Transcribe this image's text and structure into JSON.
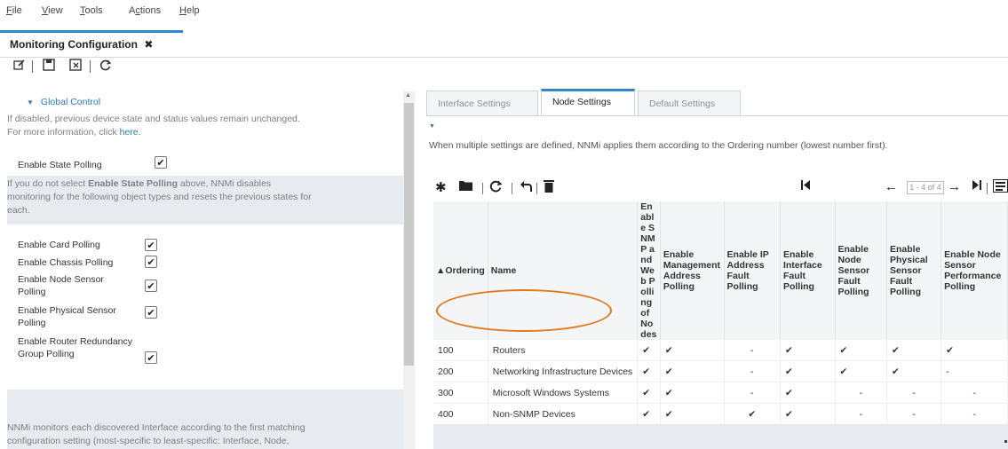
{
  "menu": {
    "items": [
      {
        "pre": "",
        "u": "F",
        "post": "ile"
      },
      {
        "pre": "",
        "u": "V",
        "post": "iew"
      },
      {
        "pre": "",
        "u": "T",
        "post": "ools"
      },
      {
        "pre": "A",
        "u": "c",
        "post": "tions"
      },
      {
        "pre": "",
        "u": "H",
        "post": "elp"
      }
    ]
  },
  "main_tab": {
    "label": "Monitoring Configuration",
    "close": "✖"
  },
  "toolbar": {
    "icons": [
      "edit-icon",
      "save-icon",
      "save-close-icon",
      "refresh-icon"
    ]
  },
  "left": {
    "global_control": "Global Control",
    "intro_line1": "If disabled, previous device state and status values remain unchanged.",
    "intro_line2": "For more information, click ",
    "intro_link": "here",
    "enable_state_polling": "Enable State Polling",
    "note_line1_pre": "If you do not select ",
    "note_line1_bold": "Enable State Polling",
    "note_line1_post": " above, NNMi disables",
    "note_line2": "monitoring for the following object types and resets the previous states for",
    "note_line3": "each.",
    "checkboxes": [
      {
        "label": "Enable Card Polling",
        "checked": true
      },
      {
        "label": "Enable Chassis Polling",
        "checked": true
      },
      {
        "label": "Enable Node Sensor Polling",
        "checked": true
      },
      {
        "label": "Enable Physical Sensor Polling",
        "checked": true
      },
      {
        "label": "Enable Router Redundancy Group Polling",
        "checked": true
      }
    ],
    "bottom_line1": "NNMi monitors each discovered Interface according to the first matching",
    "bottom_line2": "configuration setting (most-specific to least-specific: Interface, Node,"
  },
  "right": {
    "subtabs": [
      "Interface Settings",
      "Node Settings",
      "Default Settings"
    ],
    "active_subtab": "Node Settings",
    "order_note": "When multiple settings are defined, NNMi applies them according to the Ordering number (lowest number first).",
    "pager": {
      "range": "1 - 4 of 4"
    },
    "table": {
      "columns": [
        "▲Ordering",
        "Name",
        "Enable SNMP and Web Polling of Nodes",
        "Enable Management Address Polling",
        "Enable IP Address Fault Polling",
        "Enable Interface Fault Polling",
        "Enable Node Sensor Fault Polling",
        "Enable Physical Sensor Fault Polling",
        "Enable Node Sensor Performance Polling"
      ],
      "rows": [
        {
          "order": "100",
          "name": "Routers",
          "vals": [
            "✔",
            "✔",
            "-",
            "✔",
            "✔",
            "✔",
            "✔"
          ]
        },
        {
          "order": "200",
          "name": "Networking Infrastructure Devices",
          "vals": [
            "✔",
            "✔",
            "-",
            "✔",
            "✔",
            "✔",
            "-"
          ]
        },
        {
          "order": "300",
          "name": "Microsoft Windows Systems",
          "vals": [
            "✔",
            "✔",
            "-",
            "✔",
            "-",
            "-",
            "-"
          ]
        },
        {
          "order": "400",
          "name": "Non-SNMP Devices",
          "vals": [
            "✔",
            "✔",
            "✔",
            "✔",
            "-",
            "-",
            "-"
          ]
        }
      ]
    }
  },
  "colors": {
    "accent": "#2e88c9",
    "highlight_ellipse": "#e07a1c",
    "panel_bg": "#e7ebef"
  }
}
